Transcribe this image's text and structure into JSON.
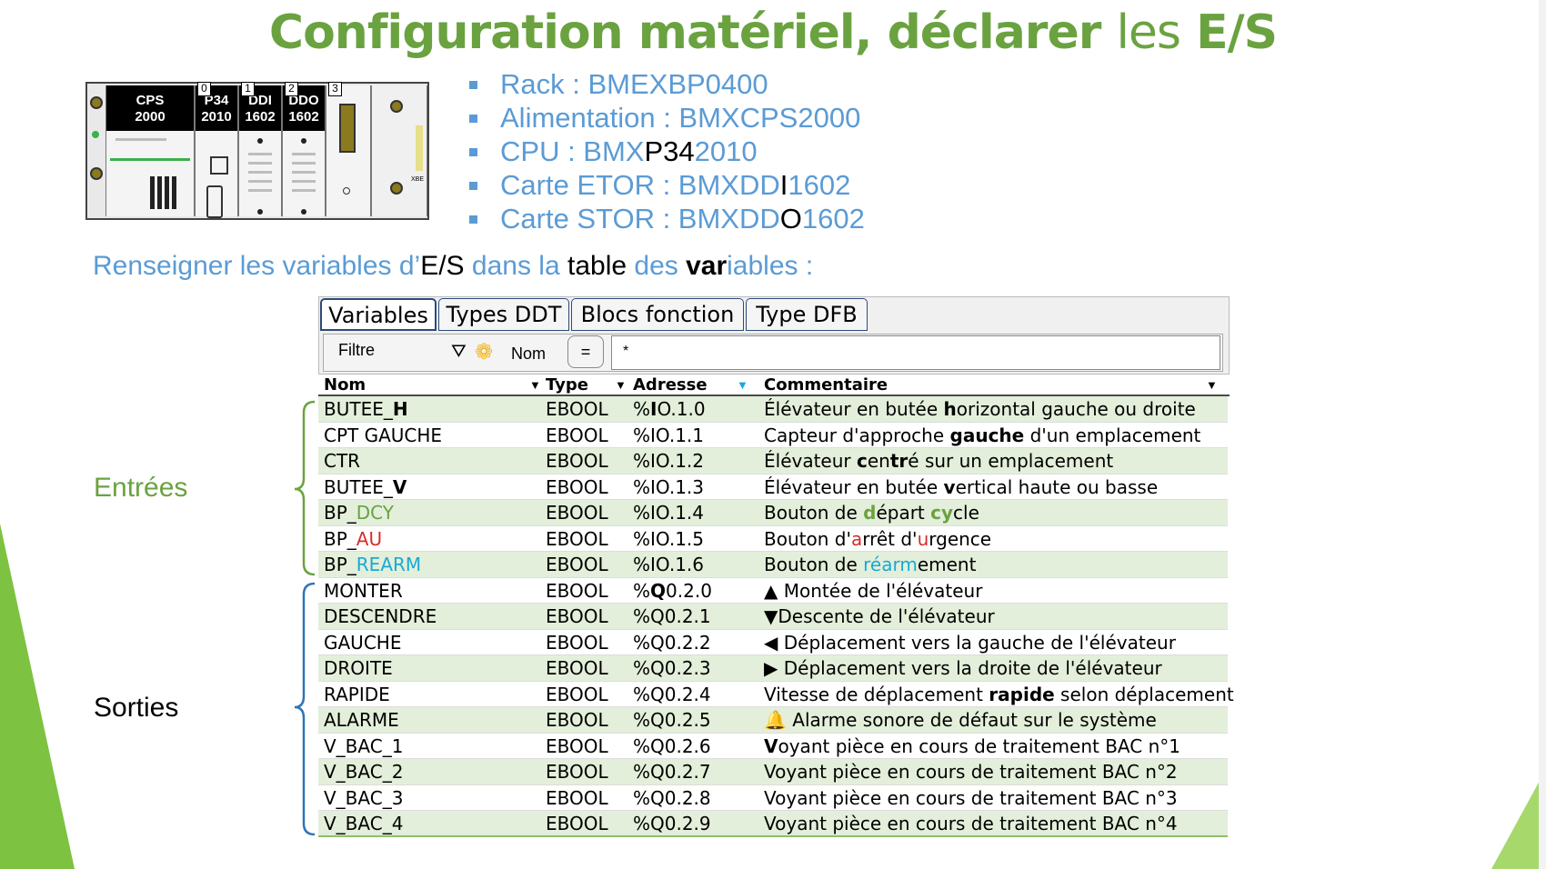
{
  "slide": {
    "title": {
      "bold1": "Configuration matériel, déclarer",
      "light": "les",
      "bold2": "E/S"
    },
    "subtitle": {
      "p1": "Renseigner les variables d’",
      "p2": "E/S",
      "p3": " dans la ",
      "p4": "table",
      "p5": " des ",
      "p6": "var",
      "p7": "iables :"
    },
    "bullets": [
      {
        "a": "Rack : BMEXBP0400",
        "b": "",
        "c": ""
      },
      {
        "a": "Alimentation : BMXCPS2000",
        "b": "",
        "c": ""
      },
      {
        "a": "CPU : BMX",
        "b": "P34",
        "c": "2010"
      },
      {
        "a": "Carte ETOR : BMXDD",
        "b": "I",
        "c": "1602"
      },
      {
        "a": "Carte STOR : BMXDD",
        "b": "O",
        "c": "1602"
      }
    ],
    "groups": {
      "inputs": "Entrées",
      "outputs": "Sorties"
    },
    "colors": {
      "green": "#6aa240",
      "blue": "#5b9bd5",
      "red": "#d92b2b",
      "cyan": "#19a9d8"
    }
  },
  "rack": {
    "modules": [
      {
        "slot": "",
        "line1": "CPS",
        "line2": "2000"
      },
      {
        "slot": "0",
        "line1": "P34",
        "line2": "2010"
      },
      {
        "slot": "1",
        "line1": "DDI",
        "line2": "1602"
      },
      {
        "slot": "2",
        "line1": "DDO",
        "line2": "1602"
      },
      {
        "slot": "3",
        "line1": "",
        "line2": ""
      }
    ],
    "label_xbe": "XBE"
  },
  "editor": {
    "tabs": [
      "Variables",
      "Types DDT",
      "Blocs fonction",
      "Type DFB"
    ],
    "filter": {
      "label": "Filtre",
      "field": "Nom",
      "operator": "=",
      "value": "*"
    },
    "columns": [
      "Nom",
      "Type",
      "Adresse",
      "Commentaire"
    ],
    "rows": [
      {
        "nom": [
          "BUTEE_",
          "H"
        ],
        "type": "EBOOL",
        "adr": [
          "%",
          "I",
          "O.1.0"
        ],
        "com": [
          "Élévateur en butée ",
          "h",
          "orizontal gauche ou droite"
        ]
      },
      {
        "nom": [
          "CPT GAUCHE"
        ],
        "type": "EBOOL",
        "adr": [
          "%IO.1.1"
        ],
        "com": [
          "Capteur d'approche ",
          "gauche",
          " d'un emplacement"
        ]
      },
      {
        "nom": [
          "CTR"
        ],
        "type": "EBOOL",
        "adr": [
          "%IO.1.2"
        ],
        "com": [
          "Élévateur ",
          "c",
          "en",
          "tr",
          "é sur un emplacement"
        ]
      },
      {
        "nom": [
          "BUTEE_",
          "V"
        ],
        "type": "EBOOL",
        "adr": [
          "%IO.1.3"
        ],
        "com": [
          "Élévateur en butée ",
          "v",
          "ertical haute ou basse"
        ]
      },
      {
        "nom": [
          "BP_",
          "DCY"
        ],
        "type": "EBOOL",
        "adr": [
          "%IO.1.4"
        ],
        "com": [
          "Bouton de ",
          "d",
          "épart ",
          "cy",
          "cle"
        ]
      },
      {
        "nom": [
          "BP_",
          "AU"
        ],
        "type": "EBOOL",
        "adr": [
          "%IO.1.5"
        ],
        "com": [
          "Bouton d'",
          "a",
          "rrêt d'",
          "u",
          "rgence"
        ]
      },
      {
        "nom": [
          "BP_",
          "REARM"
        ],
        "type": "EBOOL",
        "adr": [
          "%IO.1.6"
        ],
        "com": [
          "Bouton de ",
          "réarm",
          "ement"
        ]
      },
      {
        "nom": [
          "MONTER"
        ],
        "type": "EBOOL",
        "adr": [
          "%",
          "Q",
          "0.2.0"
        ],
        "com": [
          "▲",
          " Montée de l'élévateur"
        ]
      },
      {
        "nom": [
          "DESCENDRE"
        ],
        "type": "EBOOL",
        "adr": [
          "%Q0.2.1"
        ],
        "com": [
          "▼",
          "Descente de l'élévateur"
        ]
      },
      {
        "nom": [
          "GAUCHE"
        ],
        "type": "EBOOL",
        "adr": [
          "%Q0.2.2"
        ],
        "com": [
          "◀",
          " Déplacement vers la gauche de l'élévateur"
        ]
      },
      {
        "nom": [
          "DROITE"
        ],
        "type": "EBOOL",
        "adr": [
          "%Q0.2.3"
        ],
        "com": [
          "▶",
          " Déplacement vers la droite de l'élévateur"
        ]
      },
      {
        "nom": [
          "RAPIDE"
        ],
        "type": "EBOOL",
        "adr": [
          "%Q0.2.4"
        ],
        "com": [
          "Vitesse de déplacement ",
          "rapide",
          " selon déplacement"
        ]
      },
      {
        "nom": [
          "ALARME"
        ],
        "type": "EBOOL",
        "adr": [
          "%Q0.2.5"
        ],
        "com": [
          "🔔",
          " Alarme sonore de défaut sur le système"
        ]
      },
      {
        "nom": [
          "V_BAC_1"
        ],
        "type": "EBOOL",
        "adr": [
          "%Q0.2.6"
        ],
        "com": [
          "V",
          "oyant pièce en cours de traitement BAC n°1"
        ]
      },
      {
        "nom": [
          "V_BAC_2"
        ],
        "type": "EBOOL",
        "adr": [
          "%Q0.2.7"
        ],
        "com": [
          "Voyant pièce en cours de traitement BAC n°2"
        ]
      },
      {
        "nom": [
          "V_BAC_3"
        ],
        "type": "EBOOL",
        "adr": [
          "%Q0.2.8"
        ],
        "com": [
          "Voyant pièce en cours de traitement BAC n°3"
        ]
      },
      {
        "nom": [
          "V_BAC_4"
        ],
        "type": "EBOOL",
        "adr": [
          "%Q0.2.9"
        ],
        "com": [
          "Voyant pièce en cours de traitement BAC n°4"
        ]
      }
    ]
  }
}
